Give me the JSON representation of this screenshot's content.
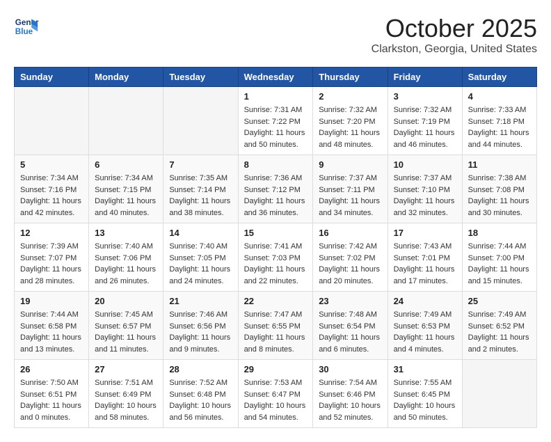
{
  "logo": {
    "line1": "General",
    "line2": "Blue"
  },
  "header": {
    "month": "October 2025",
    "location": "Clarkston, Georgia, United States"
  },
  "weekdays": [
    "Sunday",
    "Monday",
    "Tuesday",
    "Wednesday",
    "Thursday",
    "Friday",
    "Saturday"
  ],
  "weeks": [
    [
      {
        "day": "",
        "info": ""
      },
      {
        "day": "",
        "info": ""
      },
      {
        "day": "",
        "info": ""
      },
      {
        "day": "1",
        "info": "Sunrise: 7:31 AM\nSunset: 7:22 PM\nDaylight: 11 hours and 50 minutes."
      },
      {
        "day": "2",
        "info": "Sunrise: 7:32 AM\nSunset: 7:20 PM\nDaylight: 11 hours and 48 minutes."
      },
      {
        "day": "3",
        "info": "Sunrise: 7:32 AM\nSunset: 7:19 PM\nDaylight: 11 hours and 46 minutes."
      },
      {
        "day": "4",
        "info": "Sunrise: 7:33 AM\nSunset: 7:18 PM\nDaylight: 11 hours and 44 minutes."
      }
    ],
    [
      {
        "day": "5",
        "info": "Sunrise: 7:34 AM\nSunset: 7:16 PM\nDaylight: 11 hours and 42 minutes."
      },
      {
        "day": "6",
        "info": "Sunrise: 7:34 AM\nSunset: 7:15 PM\nDaylight: 11 hours and 40 minutes."
      },
      {
        "day": "7",
        "info": "Sunrise: 7:35 AM\nSunset: 7:14 PM\nDaylight: 11 hours and 38 minutes."
      },
      {
        "day": "8",
        "info": "Sunrise: 7:36 AM\nSunset: 7:12 PM\nDaylight: 11 hours and 36 minutes."
      },
      {
        "day": "9",
        "info": "Sunrise: 7:37 AM\nSunset: 7:11 PM\nDaylight: 11 hours and 34 minutes."
      },
      {
        "day": "10",
        "info": "Sunrise: 7:37 AM\nSunset: 7:10 PM\nDaylight: 11 hours and 32 minutes."
      },
      {
        "day": "11",
        "info": "Sunrise: 7:38 AM\nSunset: 7:08 PM\nDaylight: 11 hours and 30 minutes."
      }
    ],
    [
      {
        "day": "12",
        "info": "Sunrise: 7:39 AM\nSunset: 7:07 PM\nDaylight: 11 hours and 28 minutes."
      },
      {
        "day": "13",
        "info": "Sunrise: 7:40 AM\nSunset: 7:06 PM\nDaylight: 11 hours and 26 minutes."
      },
      {
        "day": "14",
        "info": "Sunrise: 7:40 AM\nSunset: 7:05 PM\nDaylight: 11 hours and 24 minutes."
      },
      {
        "day": "15",
        "info": "Sunrise: 7:41 AM\nSunset: 7:03 PM\nDaylight: 11 hours and 22 minutes."
      },
      {
        "day": "16",
        "info": "Sunrise: 7:42 AM\nSunset: 7:02 PM\nDaylight: 11 hours and 20 minutes."
      },
      {
        "day": "17",
        "info": "Sunrise: 7:43 AM\nSunset: 7:01 PM\nDaylight: 11 hours and 17 minutes."
      },
      {
        "day": "18",
        "info": "Sunrise: 7:44 AM\nSunset: 7:00 PM\nDaylight: 11 hours and 15 minutes."
      }
    ],
    [
      {
        "day": "19",
        "info": "Sunrise: 7:44 AM\nSunset: 6:58 PM\nDaylight: 11 hours and 13 minutes."
      },
      {
        "day": "20",
        "info": "Sunrise: 7:45 AM\nSunset: 6:57 PM\nDaylight: 11 hours and 11 minutes."
      },
      {
        "day": "21",
        "info": "Sunrise: 7:46 AM\nSunset: 6:56 PM\nDaylight: 11 hours and 9 minutes."
      },
      {
        "day": "22",
        "info": "Sunrise: 7:47 AM\nSunset: 6:55 PM\nDaylight: 11 hours and 8 minutes."
      },
      {
        "day": "23",
        "info": "Sunrise: 7:48 AM\nSunset: 6:54 PM\nDaylight: 11 hours and 6 minutes."
      },
      {
        "day": "24",
        "info": "Sunrise: 7:49 AM\nSunset: 6:53 PM\nDaylight: 11 hours and 4 minutes."
      },
      {
        "day": "25",
        "info": "Sunrise: 7:49 AM\nSunset: 6:52 PM\nDaylight: 11 hours and 2 minutes."
      }
    ],
    [
      {
        "day": "26",
        "info": "Sunrise: 7:50 AM\nSunset: 6:51 PM\nDaylight: 11 hours and 0 minutes."
      },
      {
        "day": "27",
        "info": "Sunrise: 7:51 AM\nSunset: 6:49 PM\nDaylight: 10 hours and 58 minutes."
      },
      {
        "day": "28",
        "info": "Sunrise: 7:52 AM\nSunset: 6:48 PM\nDaylight: 10 hours and 56 minutes."
      },
      {
        "day": "29",
        "info": "Sunrise: 7:53 AM\nSunset: 6:47 PM\nDaylight: 10 hours and 54 minutes."
      },
      {
        "day": "30",
        "info": "Sunrise: 7:54 AM\nSunset: 6:46 PM\nDaylight: 10 hours and 52 minutes."
      },
      {
        "day": "31",
        "info": "Sunrise: 7:55 AM\nSunset: 6:45 PM\nDaylight: 10 hours and 50 minutes."
      },
      {
        "day": "",
        "info": ""
      }
    ]
  ]
}
